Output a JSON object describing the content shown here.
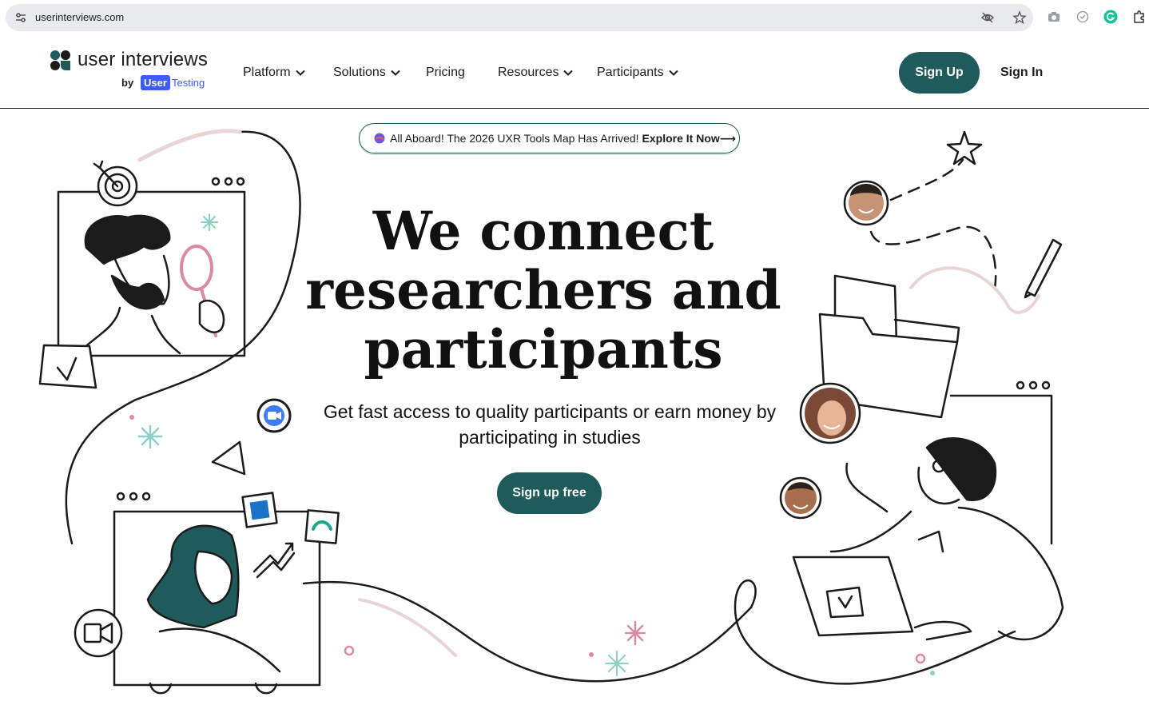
{
  "browser": {
    "url": "userinterviews.com",
    "icons": [
      "tune-icon",
      "eye-off-icon",
      "star-icon",
      "camera-icon",
      "check-circle-icon",
      "grammarly-icon",
      "puzzle-icon"
    ]
  },
  "nav": {
    "logo_text": "user interviews",
    "logo_by": "by",
    "logo_user": "User",
    "logo_testing": "Testing",
    "items": [
      {
        "label": "Platform",
        "dropdown": true
      },
      {
        "label": "Solutions",
        "dropdown": true
      },
      {
        "label": "Pricing",
        "dropdown": false
      },
      {
        "label": "Resources",
        "dropdown": true
      },
      {
        "label": "Participants",
        "dropdown": true
      }
    ],
    "signup_label": "Sign Up",
    "signin_label": "Sign In"
  },
  "hero": {
    "banner_text": "All Aboard! The 2026 UXR Tools Map Has Arrived!",
    "banner_link": "Explore It Now⟶",
    "headline_line1": "We connect",
    "headline_line2": "researchers and",
    "headline_line3": "participants",
    "subhead": "Get fast access to quality participants or earn money by participating in studies",
    "cta_label": "Sign up free"
  },
  "colors": {
    "brand_teal": "#1e5b5a",
    "usertesting_blue": "#3d5bf5",
    "accent_pink": "#d98aa6",
    "accent_mint": "#8ccfc6"
  }
}
